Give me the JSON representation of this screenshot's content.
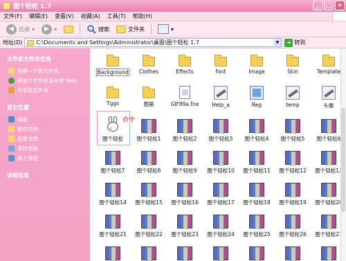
{
  "window": {
    "title": "图个轻松 1.7"
  },
  "menubar": {
    "items": [
      "文件(F)",
      "编辑(E)",
      "查看(V)",
      "收藏(A)",
      "工具(T)",
      "帮助(H)"
    ]
  },
  "toolbar": {
    "back": "后退",
    "search": "搜索",
    "folders": "文件夹"
  },
  "address": {
    "label": "地址(D)",
    "path": "C:\\Documents and Settings\\Administrator\\桌面\\图个轻松 1.7",
    "go": "转到"
  },
  "left_panel": {
    "section1_title": "文件和文件夹任务",
    "tasks1": [
      "创建一个新文件夹",
      "将这个文件夹发布到 Web",
      "共享此文件夹"
    ],
    "section2_title": "其它位置",
    "tasks2": [
      "桌面",
      "我的文档",
      "共享文档",
      "我的电脑",
      "网上邻居"
    ],
    "section3_title": "详细信息"
  },
  "files": [
    {
      "label": "Background",
      "type": "folder"
    },
    {
      "label": "Clothes",
      "type": "folder"
    },
    {
      "label": "Effects",
      "type": "folder"
    },
    {
      "label": "font",
      "type": "folder"
    },
    {
      "label": "Image",
      "type": "folder"
    },
    {
      "label": "Skin",
      "type": "folder"
    },
    {
      "label": "Template",
      "type": "folder"
    },
    {
      "label": "Tggs",
      "type": "folder"
    },
    {
      "label": "图册",
      "type": "folder"
    },
    {
      "label": "GIF89a.fne",
      "type": "file"
    },
    {
      "label": "Help_a",
      "type": "tool"
    },
    {
      "label": "Reg",
      "type": "reg"
    },
    {
      "label": "temp",
      "type": "tool"
    },
    {
      "label": "头像",
      "type": "tool"
    },
    {
      "label": "图个轻松",
      "type": "rabbit"
    },
    {
      "label": "图个轻松1",
      "type": "rar"
    },
    {
      "label": "图个轻松2",
      "type": "rar"
    },
    {
      "label": "图个轻松3",
      "type": "rar"
    },
    {
      "label": "图个轻松4",
      "type": "rar"
    },
    {
      "label": "图个轻松5",
      "type": "rar"
    },
    {
      "label": "图个轻松6",
      "type": "rar"
    },
    {
      "label": "图个轻松7",
      "type": "rar"
    },
    {
      "label": "图个轻松8",
      "type": "rar"
    },
    {
      "label": "图个轻松9",
      "type": "rar"
    },
    {
      "label": "图个轻松10",
      "type": "rar"
    },
    {
      "label": "图个轻松11",
      "type": "rar"
    },
    {
      "label": "图个轻松12",
      "type": "rar"
    },
    {
      "label": "图个轻松13",
      "type": "rar"
    },
    {
      "label": "图个轻松14",
      "type": "rar"
    },
    {
      "label": "图个轻松15",
      "type": "rar"
    },
    {
      "label": "图个轻松16",
      "type": "rar"
    },
    {
      "label": "图个轻松17",
      "type": "rar"
    },
    {
      "label": "图个轻松18",
      "type": "rar"
    },
    {
      "label": "图个轻松19",
      "type": "rar"
    },
    {
      "label": "图个轻松20",
      "type": "rar"
    },
    {
      "label": "图个轻松21",
      "type": "rar"
    },
    {
      "label": "图个轻松22",
      "type": "rar"
    },
    {
      "label": "图个轻松23",
      "type": "rar"
    },
    {
      "label": "图个轻松24",
      "type": "rar"
    },
    {
      "label": "图个轻松25",
      "type": "rar"
    },
    {
      "label": "图个轻松26",
      "type": "rar"
    },
    {
      "label": "图个轻松27",
      "type": "rar"
    },
    {
      "label": "",
      "type": "rar"
    },
    {
      "label": "",
      "type": "rar"
    },
    {
      "label": "",
      "type": "rar"
    },
    {
      "label": "",
      "type": "rar"
    },
    {
      "label": "",
      "type": "rar"
    },
    {
      "label": "",
      "type": "rar"
    },
    {
      "label": "",
      "type": "rar"
    }
  ],
  "annotation": {
    "text": "介个"
  }
}
